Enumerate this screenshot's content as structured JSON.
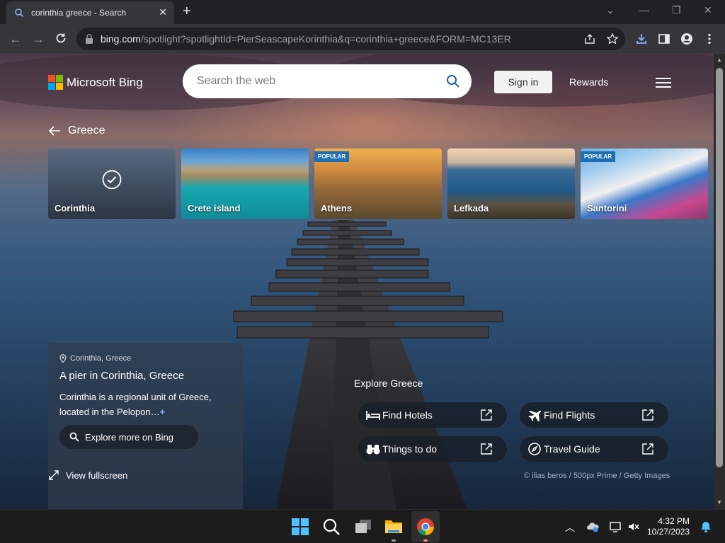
{
  "browser": {
    "tab_title": "corinthia greece - Search",
    "url_host": "bing.com",
    "url_rest": "/spotlight?spotlightId=PierSeascapeKorinthia&q=corinthia+greece&FORM=MC13ER"
  },
  "header": {
    "brand": "Microsoft Bing",
    "search_placeholder": "Search the web",
    "signin_label": "Sign in",
    "rewards_label": "Rewards"
  },
  "breadcrumb": {
    "label": "Greece"
  },
  "cards": [
    {
      "label": "Corinthia",
      "badge": "",
      "selected": true
    },
    {
      "label": "Crete island",
      "badge": ""
    },
    {
      "label": "Athens",
      "badge": "POPULAR"
    },
    {
      "label": "Lefkada",
      "badge": ""
    },
    {
      "label": "Santorini",
      "badge": "POPULAR"
    }
  ],
  "info": {
    "location": "Corinthia, Greece",
    "title": "A pier in Corinthia, Greece",
    "description": "Corinthia is a regional unit of Greece, located in the Pelopon…",
    "more_symbol": "+",
    "explore_label": "Explore more on Bing",
    "fullscreen_label": "View fullscreen"
  },
  "explore": {
    "heading": "Explore Greece",
    "buttons": [
      {
        "label": "Find Hotels",
        "icon": "bed-icon"
      },
      {
        "label": "Find Flights",
        "icon": "airplane-icon"
      },
      {
        "label": "Things to do",
        "icon": "binoculars-icon"
      },
      {
        "label": "Travel Guide",
        "icon": "compass-icon"
      }
    ]
  },
  "credit": "© ilias beros / 500px Prime / Getty Images",
  "taskbar": {
    "time": "4:32 PM",
    "date": "10/27/2023"
  },
  "colors": {
    "ms_red": "#f25022",
    "ms_green": "#7fba00",
    "ms_blue": "#00a4ef",
    "ms_yellow": "#ffb900",
    "badge_blue": "#1f6fb3"
  }
}
